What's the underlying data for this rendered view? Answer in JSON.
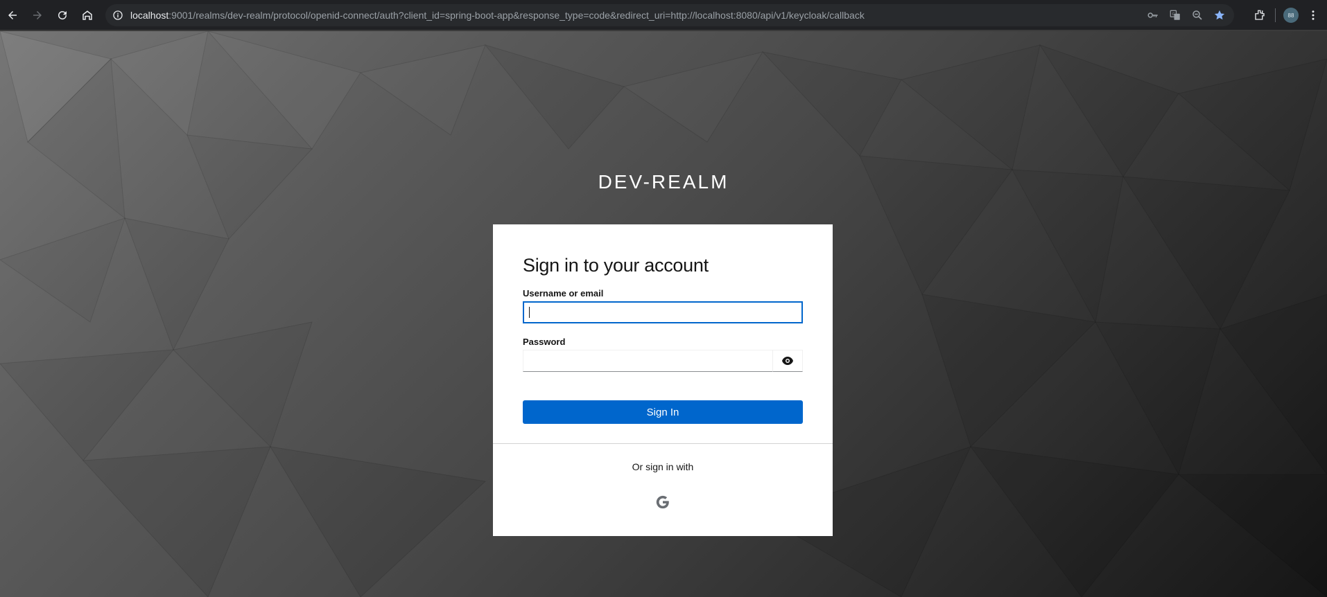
{
  "browser": {
    "url_host": "localhost",
    "url_rest": ":9001/realms/dev-realm/protocol/openid-connect/auth?client_id=spring-boot-app&response_type=code&redirect_uri=http://localhost:8080/api/v1/keycloak/callback",
    "icons": [
      "back-icon",
      "forward-icon",
      "reload-icon",
      "home-icon",
      "site-info-icon",
      "password-key-icon",
      "translate-icon",
      "zoom-icon",
      "bookmark-star-icon",
      "extensions-icon",
      "profile-avatar",
      "menu-icon"
    ],
    "avatar_text": "88",
    "bookmark_color": "#8ab4f8"
  },
  "login": {
    "realm_title": "DEV-REALM",
    "heading": "Sign in to your account",
    "username_label": "Username or email",
    "username_value": "",
    "password_label": "Password",
    "password_value": "",
    "submit_label": "Sign In",
    "social_heading": "Or sign in with",
    "social_providers": [
      "google-icon"
    ],
    "accent_color": "#0066cc"
  }
}
